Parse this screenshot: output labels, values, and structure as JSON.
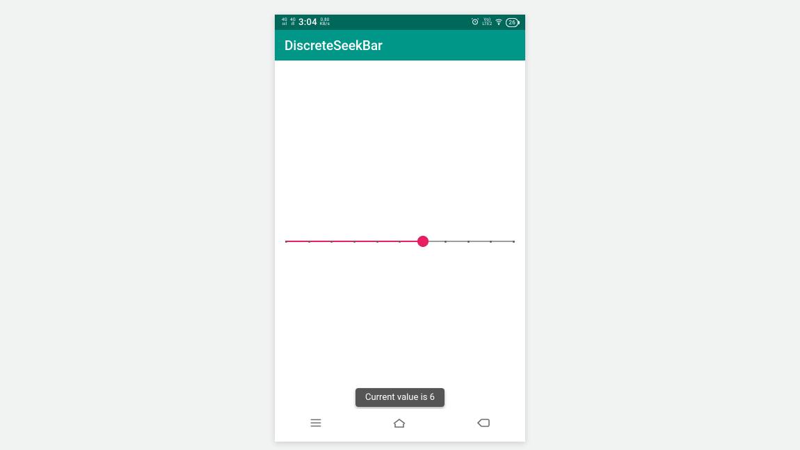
{
  "status_bar": {
    "signal1_top": "4G",
    "signal1_bottom": "ıııl",
    "signal2_top": "4G",
    "signal2_bottom": "ıll",
    "clock": "3:04",
    "net_top": "0.80",
    "net_bottom": "KB/s",
    "alarm_icon": "⏰",
    "volte_top": "Vo)",
    "volte_bottom": "LTE2",
    "wifi_icon": "📶",
    "battery_percent": "26"
  },
  "app_bar": {
    "title": "DiscreteSeekBar"
  },
  "seekbar": {
    "min": 0,
    "max": 10,
    "value": 6,
    "accent_color": "#e91e63"
  },
  "toast": {
    "text": "Current value is 6"
  },
  "nav": {
    "recent_icon": "recent-apps-icon",
    "home_icon": "home-icon",
    "back_icon": "back-icon"
  }
}
